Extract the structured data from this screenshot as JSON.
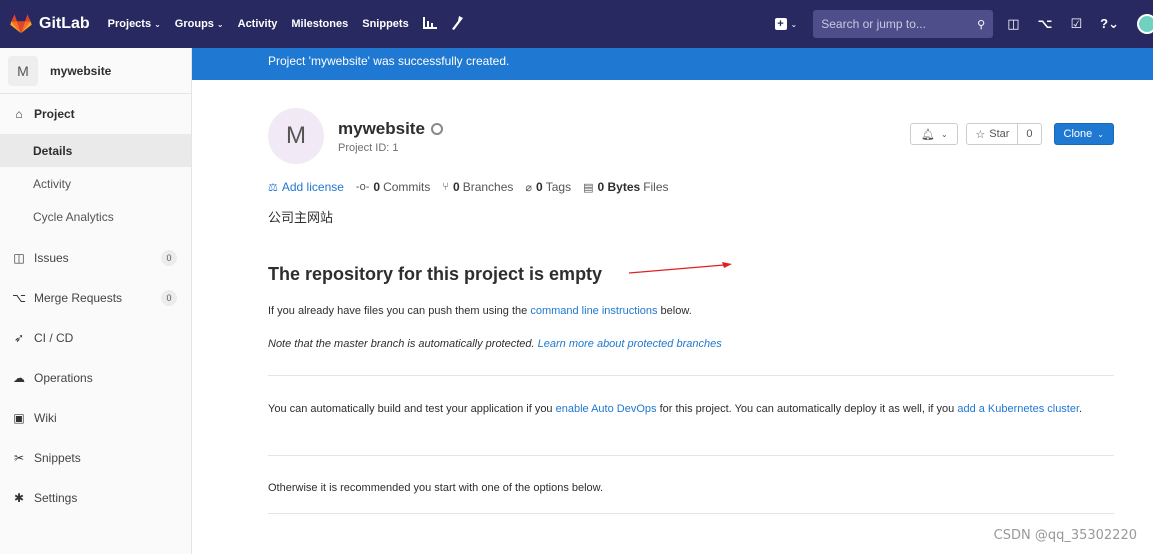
{
  "navbar": {
    "logo_text": "GitLab",
    "links": [
      {
        "label": "Projects",
        "has_dropdown": true
      },
      {
        "label": "Groups",
        "has_dropdown": true
      },
      {
        "label": "Activity",
        "has_dropdown": false
      },
      {
        "label": "Milestones",
        "has_dropdown": false
      },
      {
        "label": "Snippets",
        "has_dropdown": false
      }
    ],
    "search_placeholder": "Search or jump to...",
    "background_color": "#292961"
  },
  "sidebar": {
    "project_avatar_letter": "M",
    "project_name": "mywebsite",
    "project_label": "Project",
    "sub_items": [
      "Details",
      "Activity",
      "Cycle Analytics"
    ],
    "issues_label": "Issues",
    "issues_count": "0",
    "mr_label": "Merge Requests",
    "mr_count": "0",
    "cicd_label": "CI / CD",
    "operations_label": "Operations",
    "wiki_label": "Wiki",
    "snippets_label": "Snippets",
    "settings_label": "Settings"
  },
  "flash": {
    "message": "Project 'mywebsite' was successfully created.",
    "color": "#1f78d1"
  },
  "project": {
    "avatar_letter": "M",
    "name": "mywebsite",
    "id_text": "Project ID: 1",
    "star_label": "Star",
    "star_count": "0",
    "clone_label": "Clone",
    "add_license": "Add license",
    "commits_count": "0",
    "commits_label": "Commits",
    "branches_count": "0",
    "branches_label": "Branches",
    "tags_count": "0",
    "tags_label": "Tags",
    "files_size": "0 Bytes",
    "files_label": "Files",
    "description": "公司主网站"
  },
  "empty": {
    "title": "The repository for this project is empty",
    "p1_before": "If you already have files you can push them using the ",
    "p1_link": "command line instructions",
    "p1_after": " below.",
    "p2_text": "Note that the master branch is automatically protected. ",
    "p2_link": "Learn more about protected branches",
    "p3_before": "You can automatically build and test your application if you ",
    "p3_link1": "enable Auto DevOps",
    "p3_middle": " for this project. You can automatically deploy it as well, if you ",
    "p3_link2": "add a Kubernetes cluster",
    "p3_after": ".",
    "p4": "Otherwise it is recommended you start with one of the options below."
  },
  "watermark": "CSDN @qq_35302220"
}
